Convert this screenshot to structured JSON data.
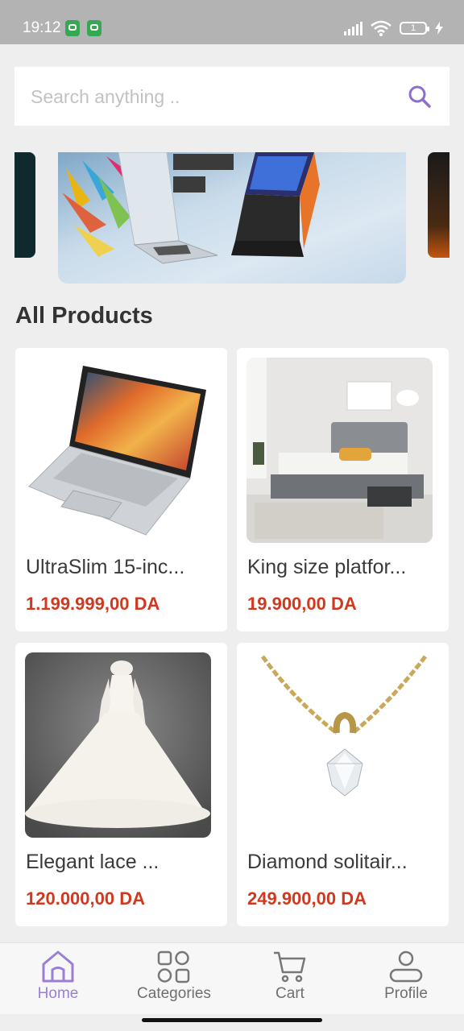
{
  "status_bar": {
    "time": "19:12",
    "battery": "1"
  },
  "search": {
    "placeholder": "Search anything .."
  },
  "section_title": "All Products",
  "products": [
    {
      "name": "UltraSlim 15-inc...",
      "price": "1.199.999,00 DA"
    },
    {
      "name": "King size platfor...",
      "price": "19.900,00 DA"
    },
    {
      "name": "Elegant lace ...",
      "price": "120.000,00 DA"
    },
    {
      "name": "Diamond solitair...",
      "price": "249.900,00 DA"
    }
  ],
  "nav": [
    {
      "label": "Home",
      "icon": "home-icon",
      "active": true
    },
    {
      "label": "Categories",
      "icon": "categories-icon",
      "active": false
    },
    {
      "label": "Cart",
      "icon": "cart-icon",
      "active": false
    },
    {
      "label": "Profile",
      "icon": "profile-icon",
      "active": false
    }
  ],
  "colors": {
    "accent": "#9b7fd6",
    "price": "#d0391f",
    "background": "#eeeeee"
  }
}
